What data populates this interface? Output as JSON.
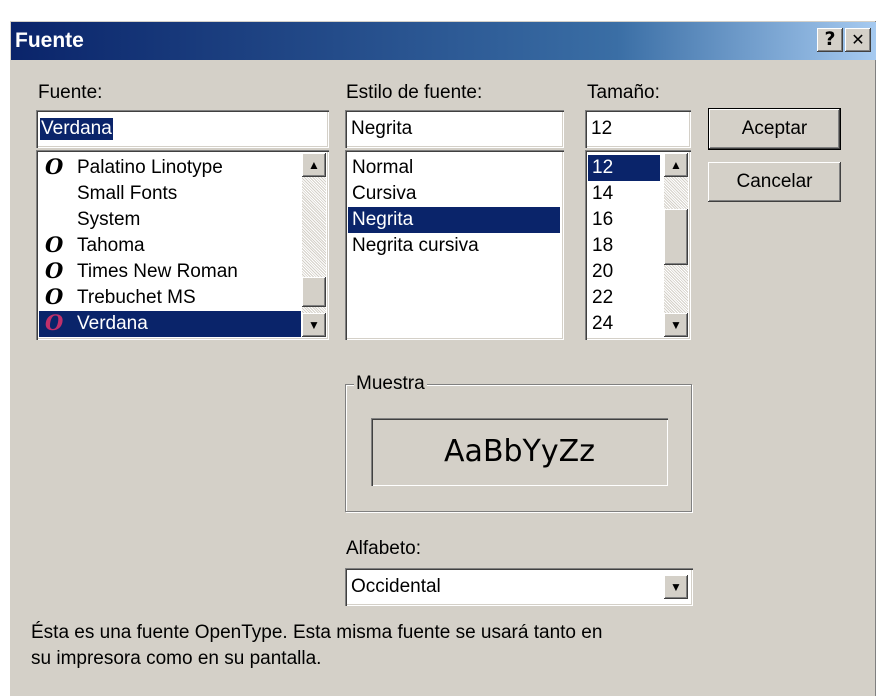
{
  "dialog": {
    "title": "Fuente",
    "help_label": "?",
    "close_label": "✕"
  },
  "font": {
    "label": "Fuente:",
    "value": "Verdana",
    "items": [
      {
        "label": "Palatino Linotype",
        "opentype": true
      },
      {
        "label": "Small Fonts",
        "opentype": false
      },
      {
        "label": "System",
        "opentype": false
      },
      {
        "label": "Tahoma",
        "opentype": true
      },
      {
        "label": "Times New Roman",
        "opentype": true
      },
      {
        "label": "Trebuchet MS",
        "opentype": true
      },
      {
        "label": "Verdana",
        "opentype": true,
        "selected": true
      }
    ],
    "opentype_glyph": "O"
  },
  "style": {
    "label": "Estilo de fuente:",
    "value": "Negrita",
    "items": [
      {
        "label": "Normal"
      },
      {
        "label": "Cursiva"
      },
      {
        "label": "Negrita",
        "selected": true
      },
      {
        "label": "Negrita cursiva"
      }
    ]
  },
  "size": {
    "label": "Tamaño:",
    "value": "12",
    "items": [
      {
        "label": "12",
        "selected": true
      },
      {
        "label": "14"
      },
      {
        "label": "16"
      },
      {
        "label": "18"
      },
      {
        "label": "20"
      },
      {
        "label": "22"
      },
      {
        "label": "24"
      }
    ]
  },
  "buttons": {
    "ok_label": "Aceptar",
    "cancel_label": "Cancelar"
  },
  "sample": {
    "legend": "Muestra",
    "text": "AaBbYyZz"
  },
  "script": {
    "label": "Alfabeto:",
    "value": "Occidental"
  },
  "description": {
    "line1": "Ésta es una fuente OpenType. Esta misma fuente se usará tanto en",
    "line2": "su impresora como en su pantalla."
  },
  "colors": {
    "selection": "#0a246a",
    "dialog_bg": "#d4d0c8",
    "opentype_icon": "#000000",
    "opentype_icon_selected": "#c0306a"
  }
}
